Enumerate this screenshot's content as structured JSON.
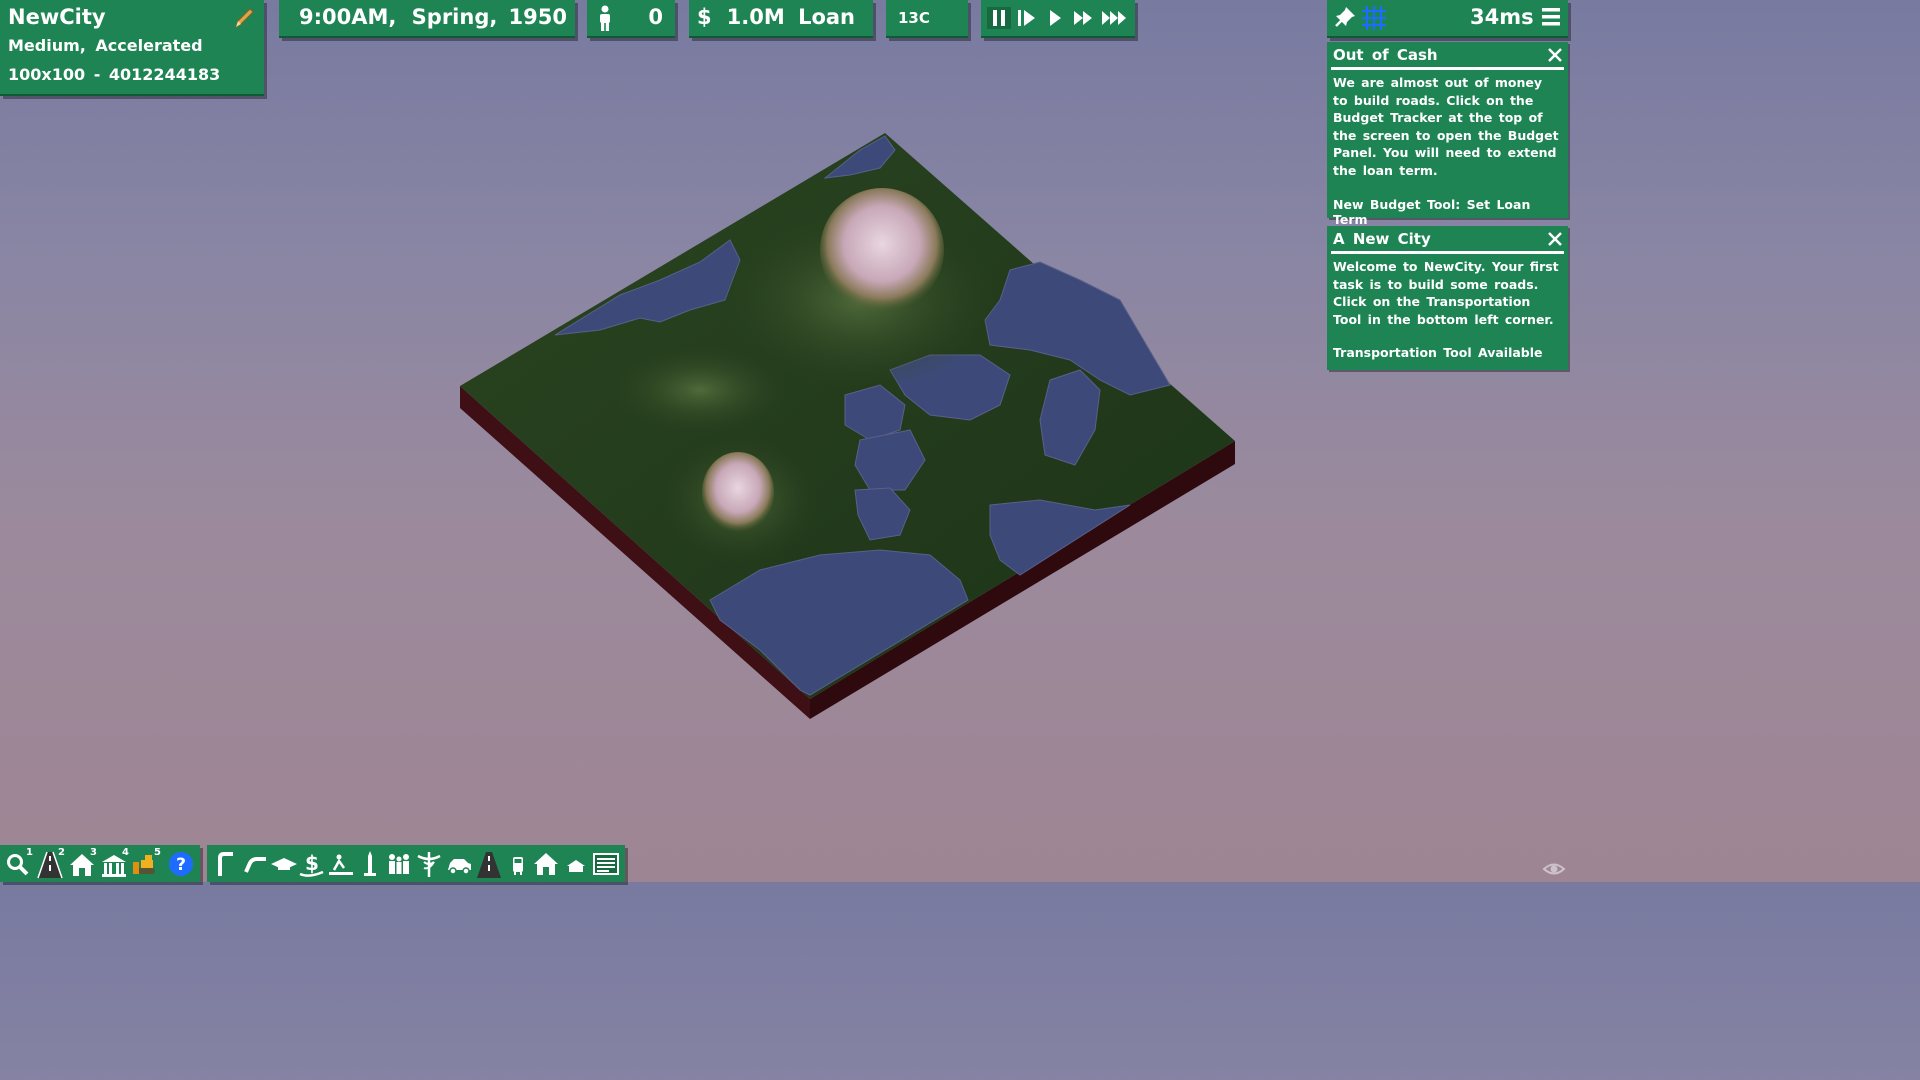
{
  "city": {
    "name": "NewCity",
    "mode": "Medium,  Accelerated",
    "seed": "100x100  -  4012244183"
  },
  "clock": {
    "time": "9:00AM,  Spring,",
    "year": "1950"
  },
  "population": {
    "value": "0"
  },
  "budget": {
    "symbol": "$",
    "value": "1.0M  Loan"
  },
  "weather": {
    "temperature": "13C"
  },
  "performance": {
    "frame_time": "34ms"
  },
  "messages": [
    {
      "title": "Out of Cash",
      "body": "We are almost out of money to build roads. Click on the Budget Tracker at the top of the screen to open the Budget Panel. You will need to extend the loan term.",
      "footer": "New Budget Tool: Set Loan Term"
    },
    {
      "title": "A New City",
      "body": "Welcome to NewCity. Your first task is to build some roads. Click on the Transportation Tool in the bottom left corner.",
      "footer": "Transportation Tool Available"
    }
  ],
  "toolbar": {
    "hotkeys": [
      "1",
      "2",
      "3",
      "4",
      "5"
    ],
    "icons": [
      "query-icon",
      "road-icon",
      "house-icon",
      "government-icon",
      "bulldozer-icon",
      "help-icon"
    ]
  },
  "colors": {
    "panel": "#1e8454",
    "accent_blue": "#1e6cff",
    "land": "#233a1c",
    "water": "#3e4b78",
    "cliff": "#3a0f12"
  }
}
